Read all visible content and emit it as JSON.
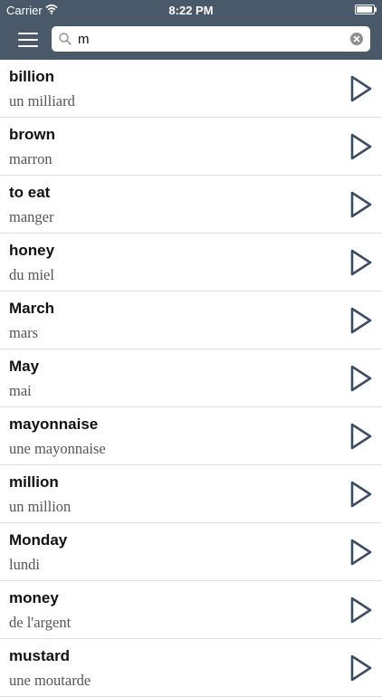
{
  "status_bar": {
    "carrier": "Carrier",
    "time": "8:22 PM"
  },
  "search": {
    "query": "m",
    "icon": "search-icon",
    "clear_icon": "clear-icon"
  },
  "header": {
    "menu_icon": "hamburger-menu-icon",
    "background": "#4a5969"
  },
  "entries": [
    {
      "english": "billion",
      "french": "un milliard"
    },
    {
      "english": "brown",
      "french": "marron"
    },
    {
      "english": "to eat",
      "french": "manger"
    },
    {
      "english": "honey",
      "french": "du miel"
    },
    {
      "english": "March",
      "french": "mars"
    },
    {
      "english": "May",
      "french": "mai"
    },
    {
      "english": "mayonnaise",
      "french": "une mayonnaise"
    },
    {
      "english": "million",
      "french": "un million"
    },
    {
      "english": "Monday",
      "french": "lundi"
    },
    {
      "english": "money",
      "french": "de l'argent"
    },
    {
      "english": "mustard",
      "french": "une moutarde"
    }
  ],
  "play_icon": "play-icon",
  "accent_color": "#3d4e63"
}
